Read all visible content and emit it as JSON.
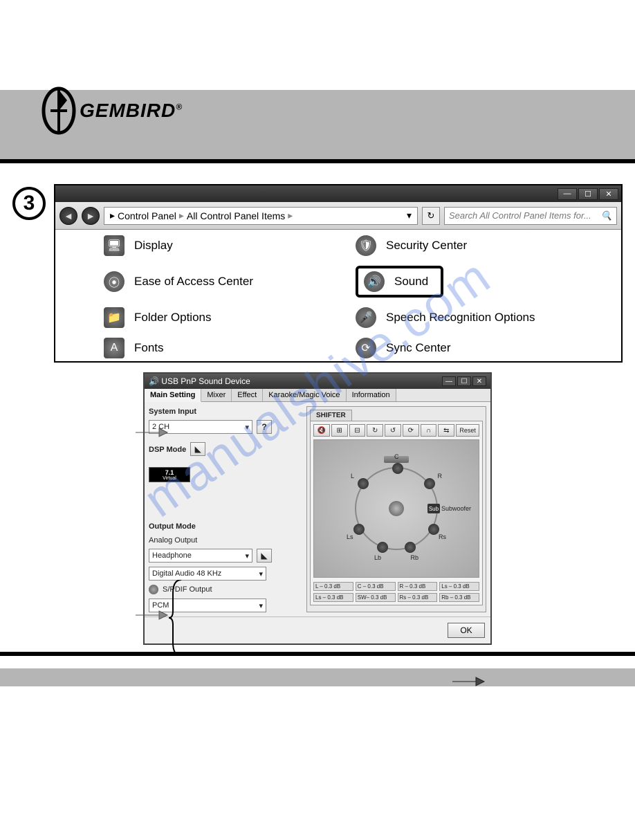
{
  "brand": "GEMBIRD",
  "step_number": "3",
  "explorer": {
    "breadcrumb": {
      "root": "Control Panel",
      "sub": "All Control Panel Items"
    },
    "search_placeholder": "Search All Control Panel Items for...",
    "items_left": [
      "Display",
      "Ease of Access Center",
      "Folder Options",
      "Fonts"
    ],
    "items_right": [
      "Security Center",
      "Sound",
      "Speech Recognition Options",
      "Sync Center"
    ]
  },
  "dialog": {
    "title": "USB PnP Sound Device",
    "tabs": [
      "Main Setting",
      "Mixer",
      "Effect",
      "Karaoke/Magic Voice",
      "Information"
    ],
    "system_input_label": "System Input",
    "system_input_value": "2 CH",
    "dsp_mode_label": "DSP Mode",
    "virtual_badge": "7.1 Virtual",
    "output_mode_label": "Output Mode",
    "analog_output_label": "Analog Output",
    "analog_output_value": "Headphone",
    "digital_value": "Digital Audio 48 KHz",
    "spdif_label": "S/PDIF Output",
    "spdif_value": "PCM",
    "shifter_label": "SHIFTER",
    "toolbar": [
      "🔇",
      "⊞",
      "⊟",
      "↻",
      "↺",
      "⟳",
      "∩",
      "⇆"
    ],
    "reset_label": "Reset",
    "speakers": {
      "C": "C",
      "L": "L",
      "R": "R",
      "Ls": "Ls",
      "Rs": "Rs",
      "Lb": "Lb",
      "Rb": "Rb",
      "Sub": "Sub"
    },
    "sub_text": "Subwoofer",
    "db_cells": [
      "L  – 0.3 dB",
      "C  – 0.3 dB",
      "R  – 0.3 dB",
      "Ls – 0.3 dB",
      "Ls – 0.3 dB",
      "SW– 0.3 dB",
      "Rs – 0.3 dB",
      "Rb – 0.3 dB"
    ],
    "ok_label": "OK"
  },
  "watermark": "manualshive.com"
}
